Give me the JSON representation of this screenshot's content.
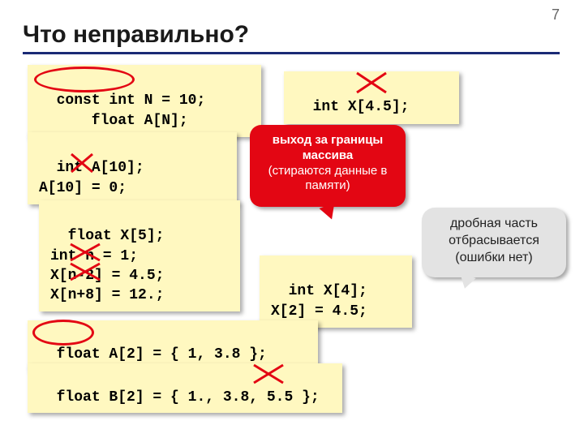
{
  "page_number": "7",
  "title": "Что неправильно?",
  "box1": {
    "line1_pre": "const int",
    "line1_post": " N = 10;",
    "line2": "      float A[N];"
  },
  "box2": {
    "pre": "int X[",
    "mid": "4.5",
    "post": "];"
  },
  "box3": {
    "line1": "int A[10];",
    "line2_pre": "A[",
    "line2_mid": "10",
    "line2_post": "] = 0;"
  },
  "box4": {
    "line1": "float X[5];",
    "line2": "int n = 1;",
    "line3_pre": "X[",
    "line3_mid": "n-2",
    "line3_post": "] = 4.5;",
    "line4_pre": "X[",
    "line4_mid": "n+8",
    "line4_post": "] = 12.;"
  },
  "box5": {
    "line1": "int X[4];",
    "line2": "X[2] = 4.5;"
  },
  "box6": {
    "pre": "float",
    "post": " A[2] = { 1, 3.8 };"
  },
  "box7": {
    "pre": "float B[2] = { 1., 3.8, ",
    "mid": "5.5",
    "post": " };"
  },
  "callout_red": {
    "bold": "выход за границы массива",
    "small": "(стираются данные в памяти)"
  },
  "callout_grey": {
    "line1": "дробная часть",
    "line2": "отбрасывается",
    "line3": "(ошибки нет)"
  }
}
